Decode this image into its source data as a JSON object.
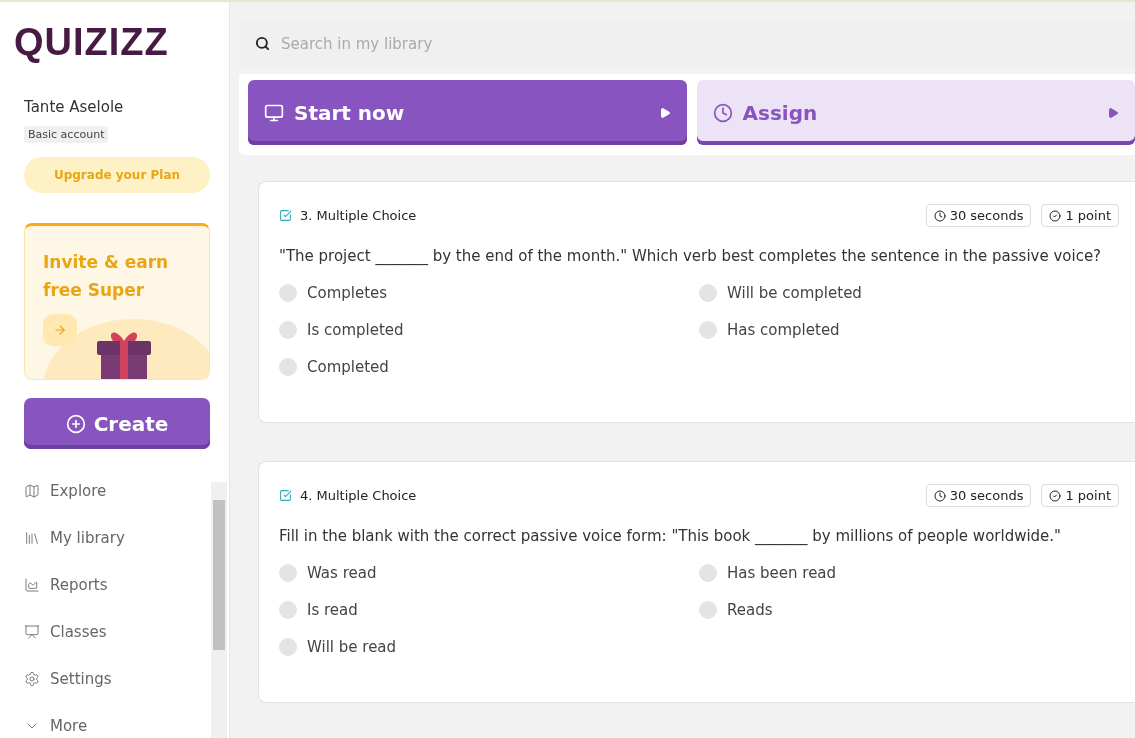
{
  "sidebar": {
    "logo": "QUIZIZZ",
    "user_name": "Tante Aselole",
    "account_badge": "Basic account",
    "upgrade_button": "Upgrade your Plan",
    "invite_card": {
      "title": "Invite & earn free Super"
    },
    "create_button": "Create",
    "nav_items": [
      {
        "label": "Explore"
      },
      {
        "label": "My library"
      },
      {
        "label": "Reports"
      },
      {
        "label": "Classes"
      },
      {
        "label": "Settings"
      },
      {
        "label": "More"
      }
    ]
  },
  "search": {
    "placeholder": "Search in my library"
  },
  "actions": [
    {
      "label": "Start now",
      "kind": "primary"
    },
    {
      "label": "Assign",
      "kind": "secondary"
    }
  ],
  "questions": [
    {
      "title": "3. Multiple Choice",
      "time": "30 seconds",
      "points": "1 point",
      "text": "\"The project _______ by the end of the month.\" Which verb best completes the sentence in the passive voice?",
      "options": [
        "Completes",
        "Will be completed",
        "Is completed",
        "Has completed",
        "Completed"
      ]
    },
    {
      "title": "4. Multiple Choice",
      "time": "30 seconds",
      "points": "1 point",
      "text": "Fill in the blank with the correct passive voice form: \"This book _______ by millions of people worldwide.\"",
      "options": [
        "Was read",
        "Has been read",
        "Is read",
        "Reads",
        "Will be read"
      ]
    }
  ]
}
